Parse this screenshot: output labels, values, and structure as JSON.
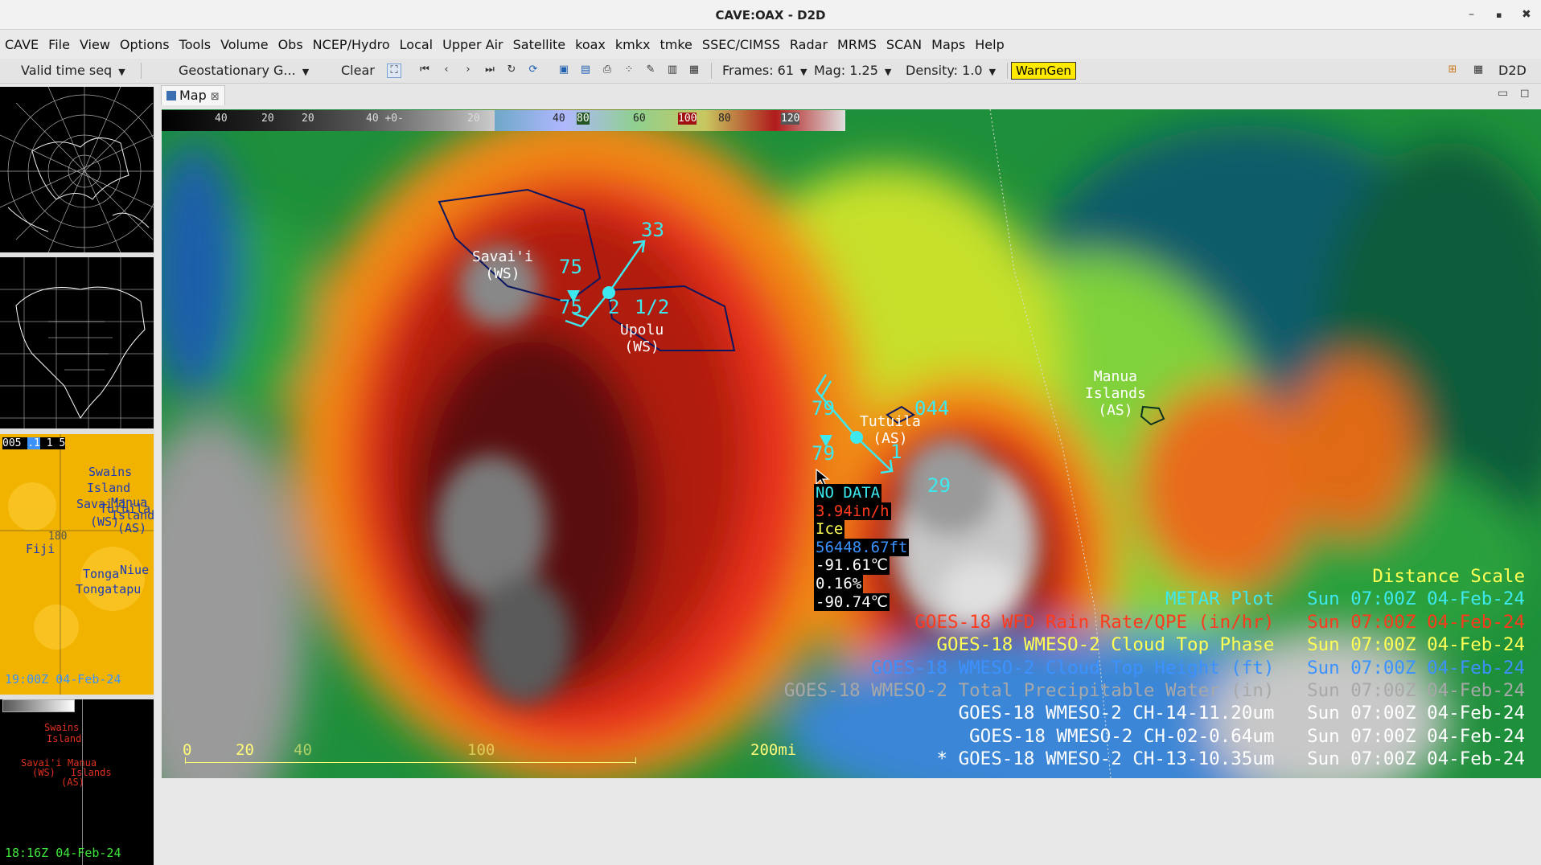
{
  "window": {
    "title": "CAVE:OAX - D2D",
    "min": "–",
    "max": "▪",
    "close": "✖"
  },
  "menu": [
    "CAVE",
    "File",
    "View",
    "Options",
    "Tools",
    "Volume",
    "Obs",
    "NCEP/Hydro",
    "Local",
    "Upper Air",
    "Satellite",
    "koax",
    "kmkx",
    "tmke",
    "SSEC/CIMSS",
    "Radar",
    "MRMS",
    "SCAN",
    "Maps",
    "Help"
  ],
  "toolbar": {
    "valid_time": "Valid time seq",
    "projection": "Geostationary G...",
    "clear": "Clear",
    "frames": "Frames: 61",
    "mag": "Mag: 1.25",
    "density": "Density: 1.0",
    "warngen": "WarnGen",
    "perspective": "D2D"
  },
  "tab": {
    "label": "Map",
    "close": "⊠"
  },
  "colorbar": {
    "labels": [
      "40",
      "20",
      "20",
      "40 +0-",
      "20",
      "40",
      "80",
      "60",
      "100",
      "80",
      "120"
    ],
    "colors": [
      "#101010",
      "#404040",
      "#606060",
      "#909090",
      "#bcbcbc",
      "#6fa8c8",
      "#b0b8ff",
      "#8fd08f",
      "#c8c860",
      "#b01c1c",
      "#e0e0e0"
    ]
  },
  "left_panes": {
    "pane3_header": [
      "005",
      ".1",
      "1",
      "5"
    ],
    "pane3_labels": [
      "Swains",
      "Island",
      "Savai'i",
      "Manua",
      "Tutuila",
      "Islands",
      "(WS)",
      "(AS)",
      "Fiji",
      "180",
      "Tonga",
      "Niue",
      "Tongatapu"
    ],
    "pane3_time": "19:00Z 04-Feb-24",
    "pane4_labels": [
      "Swains",
      "Island",
      "Savai'i",
      "Manua",
      "(WS)",
      "Islands",
      "(AS)"
    ],
    "pane4_time": "18:16Z 04-Feb-24"
  },
  "map": {
    "stations": [
      {
        "name": "Savai'i",
        "sub": "(WS)"
      },
      {
        "name": "Upolu",
        "sub": "(WS)"
      },
      {
        "name": "Tutuila",
        "sub": "(AS)"
      },
      {
        "name": "Manua",
        "sub": "Islands",
        "sub2": "(AS)"
      }
    ],
    "obs_upolu": {
      "temp": "75",
      "dew": "75",
      "vis": "1/2",
      "code": "2",
      "speed": "33"
    },
    "obs_tutuila": {
      "temp": "79",
      "dew": "79",
      "pressure": "044",
      "code": "1",
      "speed": "29"
    }
  },
  "sample": [
    {
      "text": "NO DATA",
      "color": "#3ee8ef"
    },
    {
      "text": "3.94in/h",
      "color": "#ff3a1c"
    },
    {
      "text": "Ice",
      "color": "#ffff55"
    },
    {
      "text": "56448.67ft",
      "color": "#3b92ff"
    },
    {
      "text": "-91.61℃",
      "color": "#ffffff"
    },
    {
      "text": "0.16%",
      "color": "#ffffff"
    },
    {
      "text": "-90.74℃",
      "color": "#ffffff"
    }
  ],
  "legend": [
    {
      "name": "Distance Scale",
      "time": "",
      "color": "#ffff55"
    },
    {
      "name": "METAR Plot",
      "time": "Sun 07:00Z 04-Feb-24",
      "color": "#3ee8ef"
    },
    {
      "name": "GOES-18 WFD Rain Rate/QPE (in/hr)",
      "time": "Sun 07:00Z 04-Feb-24",
      "color": "#ff3a1c"
    },
    {
      "name": "GOES-18 WMESO-2 Cloud Top Phase",
      "time": "Sun 07:00Z 04-Feb-24",
      "color": "#ffff55"
    },
    {
      "name": "GOES-18 WMESO-2 Cloud Top Height (ft)",
      "time": "Sun 07:00Z 04-Feb-24",
      "color": "#3b92ff"
    },
    {
      "name": "GOES-18 WMESO-2 Total Precipitable Water (in)",
      "time": "Sun 07:00Z 04-Feb-24",
      "color": "#a8a8a8"
    },
    {
      "name": "GOES-18 WMESO-2 CH-14-11.20um",
      "time": "Sun 07:00Z 04-Feb-24",
      "color": "#ffffff"
    },
    {
      "name": "GOES-18 WMESO-2 CH-02-0.64um",
      "time": "Sun 07:00Z 04-Feb-24",
      "color": "#ffffff"
    },
    {
      "name": "* GOES-18 WMESO-2 CH-13-10.35um",
      "time": "Sun 07:00Z 04-Feb-24",
      "color": "#ffffff"
    }
  ],
  "scale": {
    "ticks": [
      "0",
      "20",
      "40",
      "100",
      "200mi"
    ]
  }
}
